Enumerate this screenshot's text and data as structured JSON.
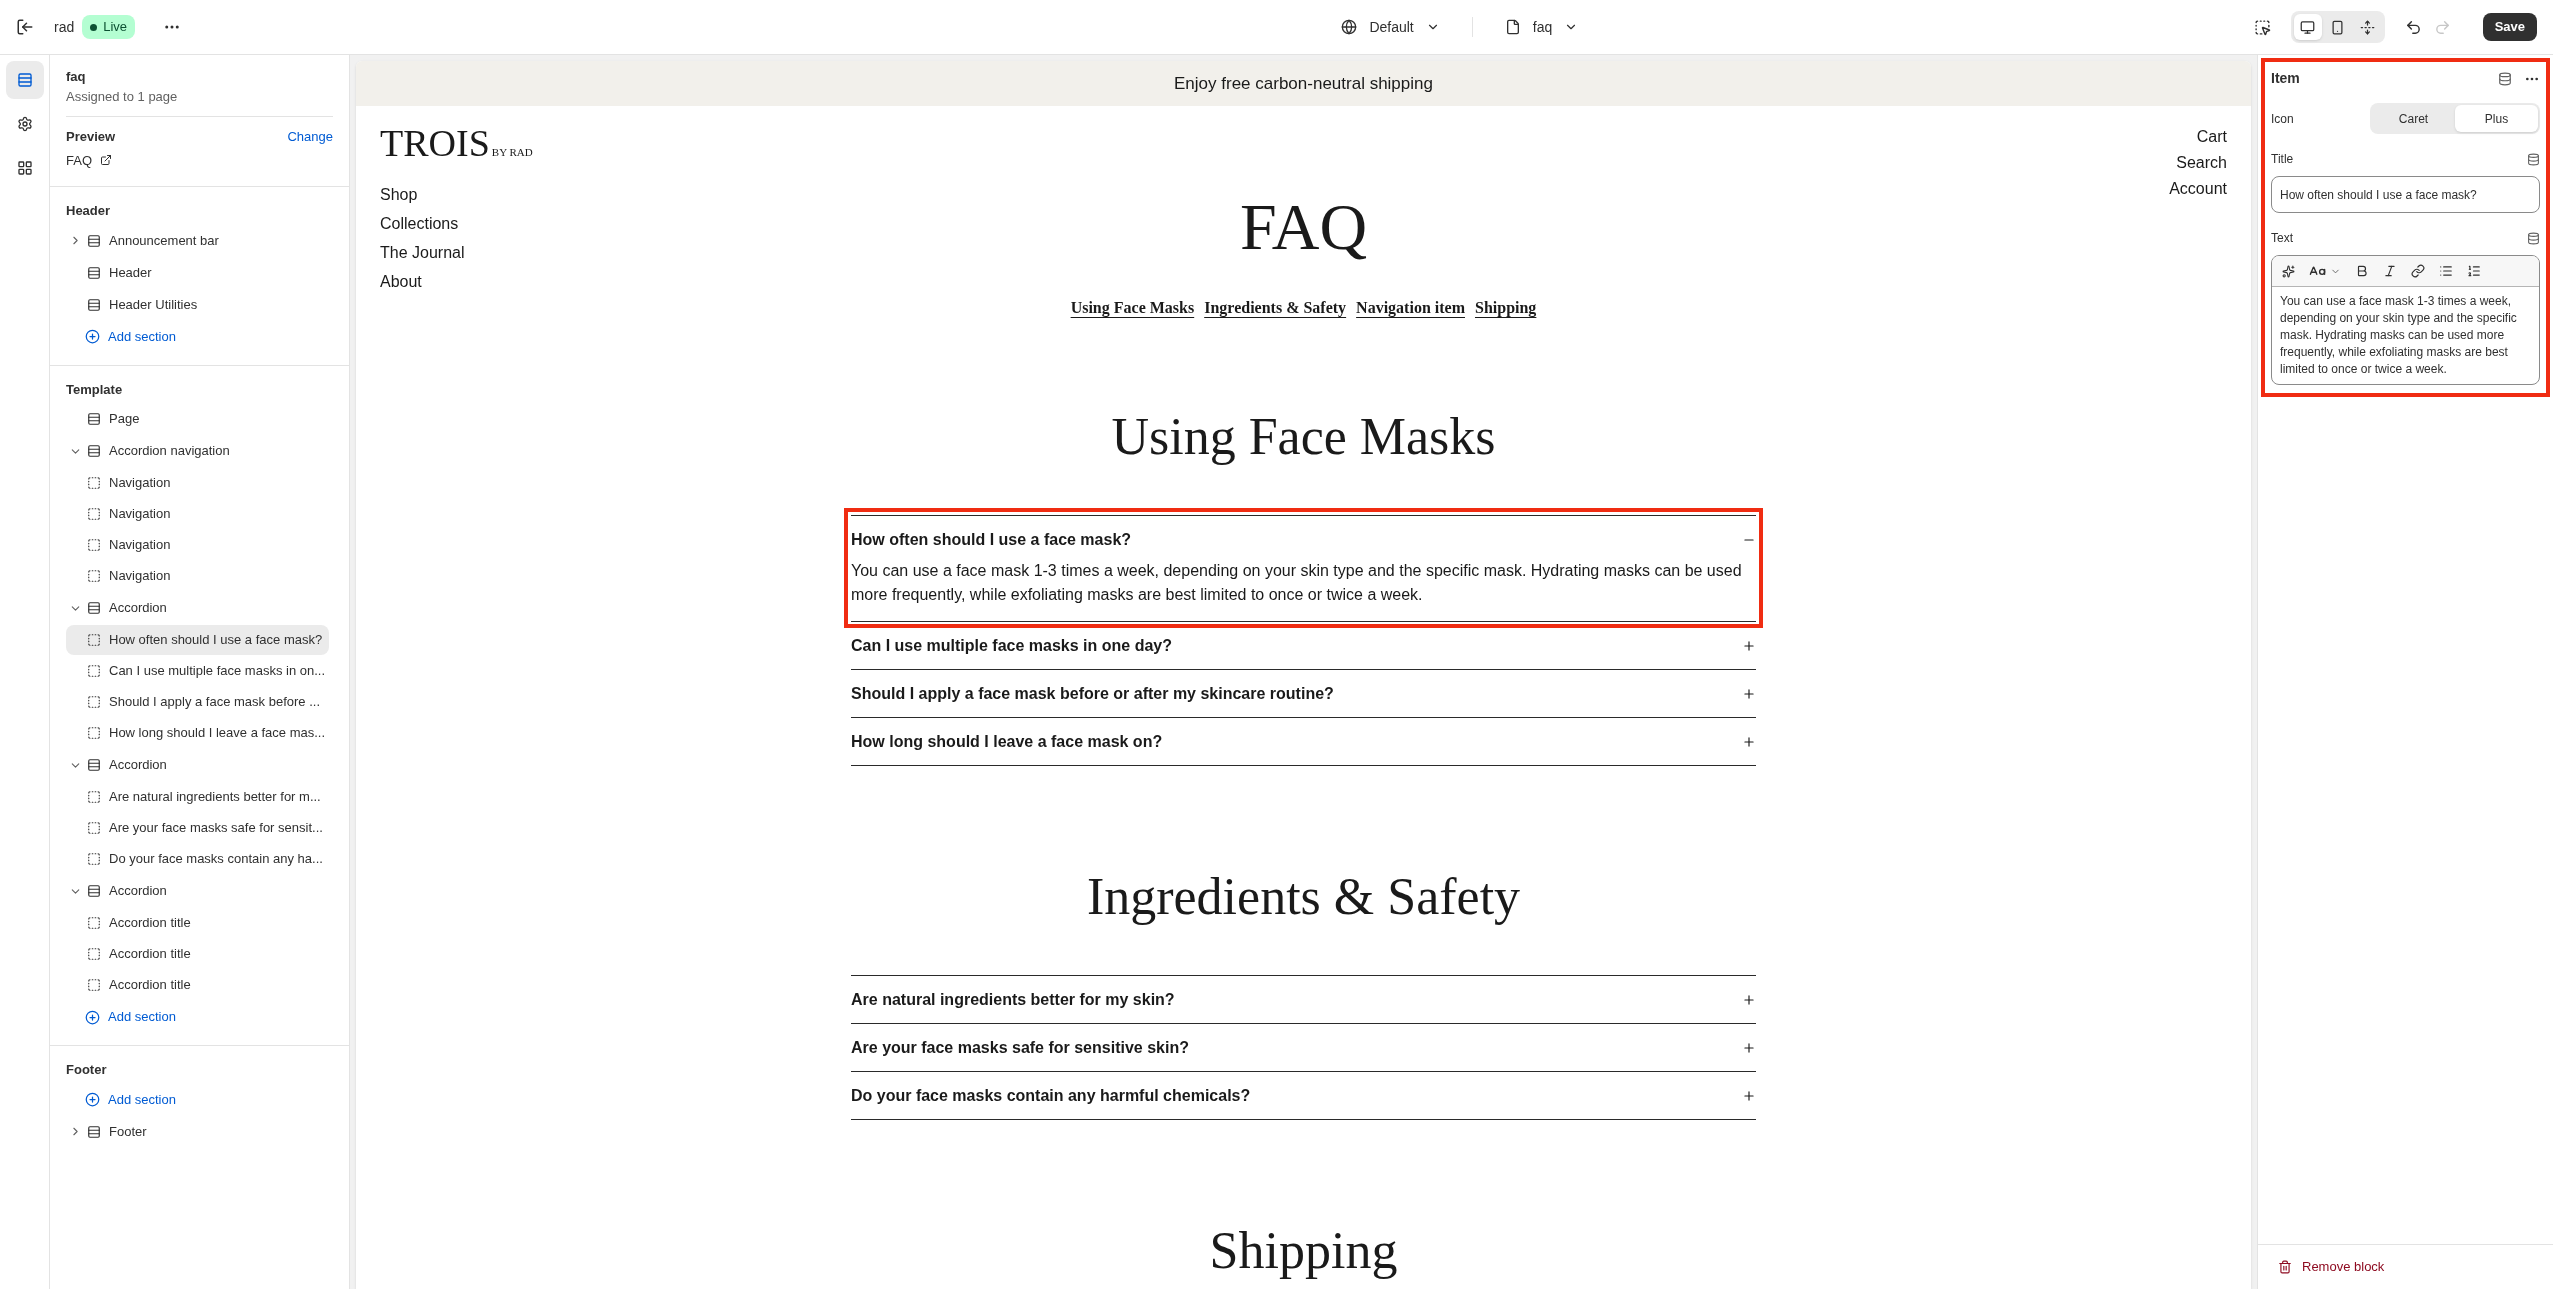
{
  "topbar": {
    "store": "rad",
    "status": "Live",
    "theme": "Default",
    "template": "faq",
    "save": "Save",
    "view_modes": [
      {
        "kind": "desktop",
        "selected": true
      },
      {
        "kind": "mobile",
        "selected": false
      },
      {
        "kind": "fullwidth",
        "selected": false
      }
    ]
  },
  "rail": [
    {
      "kind": "sections",
      "selected": true
    },
    {
      "kind": "settings",
      "selected": false
    },
    {
      "kind": "apps",
      "selected": false
    }
  ],
  "sidebar": {
    "title": "faq",
    "subtitle": "Assigned to 1 page",
    "preview_label": "Preview",
    "change": "Change",
    "preview_page": "FAQ",
    "groups": [
      {
        "title": "Header",
        "add": "Add section",
        "items": [
          {
            "label": "Announcement bar",
            "expanded": false
          },
          {
            "label": "Header"
          },
          {
            "label": "Header Utilities"
          }
        ]
      },
      {
        "title": "Template",
        "add": "Add section",
        "items": [
          {
            "label": "Page"
          },
          {
            "label": "Accordion navigation",
            "expanded": true,
            "children": [
              {
                "label": "Navigation",
                "selected": false
              },
              {
                "label": "Navigation",
                "selected": false
              },
              {
                "label": "Navigation",
                "selected": false
              },
              {
                "label": "Navigation",
                "selected": false
              }
            ]
          },
          {
            "label": "Accordion",
            "expanded": true,
            "children": [
              {
                "label": "How often should I use a face mask?",
                "selected": true
              },
              {
                "label": "Can I use multiple face masks in on...",
                "selected": false
              },
              {
                "label": "Should I apply a face mask before ...",
                "selected": false
              },
              {
                "label": "How long should I leave a face mas...",
                "selected": false
              }
            ]
          },
          {
            "label": "Accordion",
            "expanded": true,
            "children": [
              {
                "label": "Are natural ingredients better for m...",
                "selected": false
              },
              {
                "label": "Are your face masks safe for sensit...",
                "selected": false
              },
              {
                "label": "Do your face masks contain any ha...",
                "selected": false
              }
            ]
          },
          {
            "label": "Accordion",
            "expanded": true,
            "children": [
              {
                "label": "Accordion title",
                "selected": false
              },
              {
                "label": "Accordion title",
                "selected": false
              },
              {
                "label": "Accordion title",
                "selected": false
              }
            ]
          }
        ]
      },
      {
        "title": "Footer",
        "add": "Add section",
        "items": [
          {
            "label": "Footer",
            "expanded": false
          }
        ]
      }
    ]
  },
  "preview": {
    "announcement": "Enjoy free carbon-neutral shipping",
    "logo": "TROIS",
    "logo_sub": "BY RAD",
    "nav_left": [
      "Shop",
      "Collections",
      "The Journal",
      "About"
    ],
    "nav_right": [
      "Cart",
      "Search",
      "Account"
    ],
    "page_title": "FAQ",
    "anchors": [
      "Using Face Masks",
      "Ingredients & Safety",
      "Navigation item",
      "Shipping"
    ],
    "sections": [
      {
        "title": "Using Face Masks",
        "items": [
          {
            "question": "How often should I use a face mask?",
            "answer": "You can use a face mask 1-3 times a week, depending on your skin type and the specific mask. Hydrating masks can be used more frequently, while exfoliating masks are best limited to once or twice a week.",
            "expanded": true,
            "selected": true
          },
          {
            "question": "Can I use multiple face masks in one day?",
            "expanded": false,
            "selected": false
          },
          {
            "question": "Should I apply a face mask before or after my skincare routine?",
            "expanded": false,
            "selected": false
          },
          {
            "question": "How long should I leave a face mask on?",
            "expanded": false,
            "selected": false
          }
        ]
      },
      {
        "title": "Ingredients & Safety",
        "items": [
          {
            "question": "Are natural ingredients better for my skin?",
            "expanded": false,
            "selected": false
          },
          {
            "question": "Are your face masks safe for sensitive skin?",
            "expanded": false,
            "selected": false
          },
          {
            "question": "Do your face masks contain any harmful chemicals?",
            "expanded": false,
            "selected": false
          }
        ]
      },
      {
        "title": "Shipping"
      }
    ]
  },
  "panel": {
    "title": "Item",
    "icon_label": "Icon",
    "icon_options": [
      {
        "label": "Caret",
        "selected": false
      },
      {
        "label": "Plus",
        "selected": true
      }
    ],
    "title_label": "Title",
    "title_value": "How often should I use a face mask?",
    "text_label": "Text",
    "text_value": "You can use a face mask 1-3 times a week, depending on your skin type and the specific mask. Hydrating masks can be used more frequently, while exfoliating masks are best limited to once or twice a week.",
    "remove": "Remove block"
  }
}
